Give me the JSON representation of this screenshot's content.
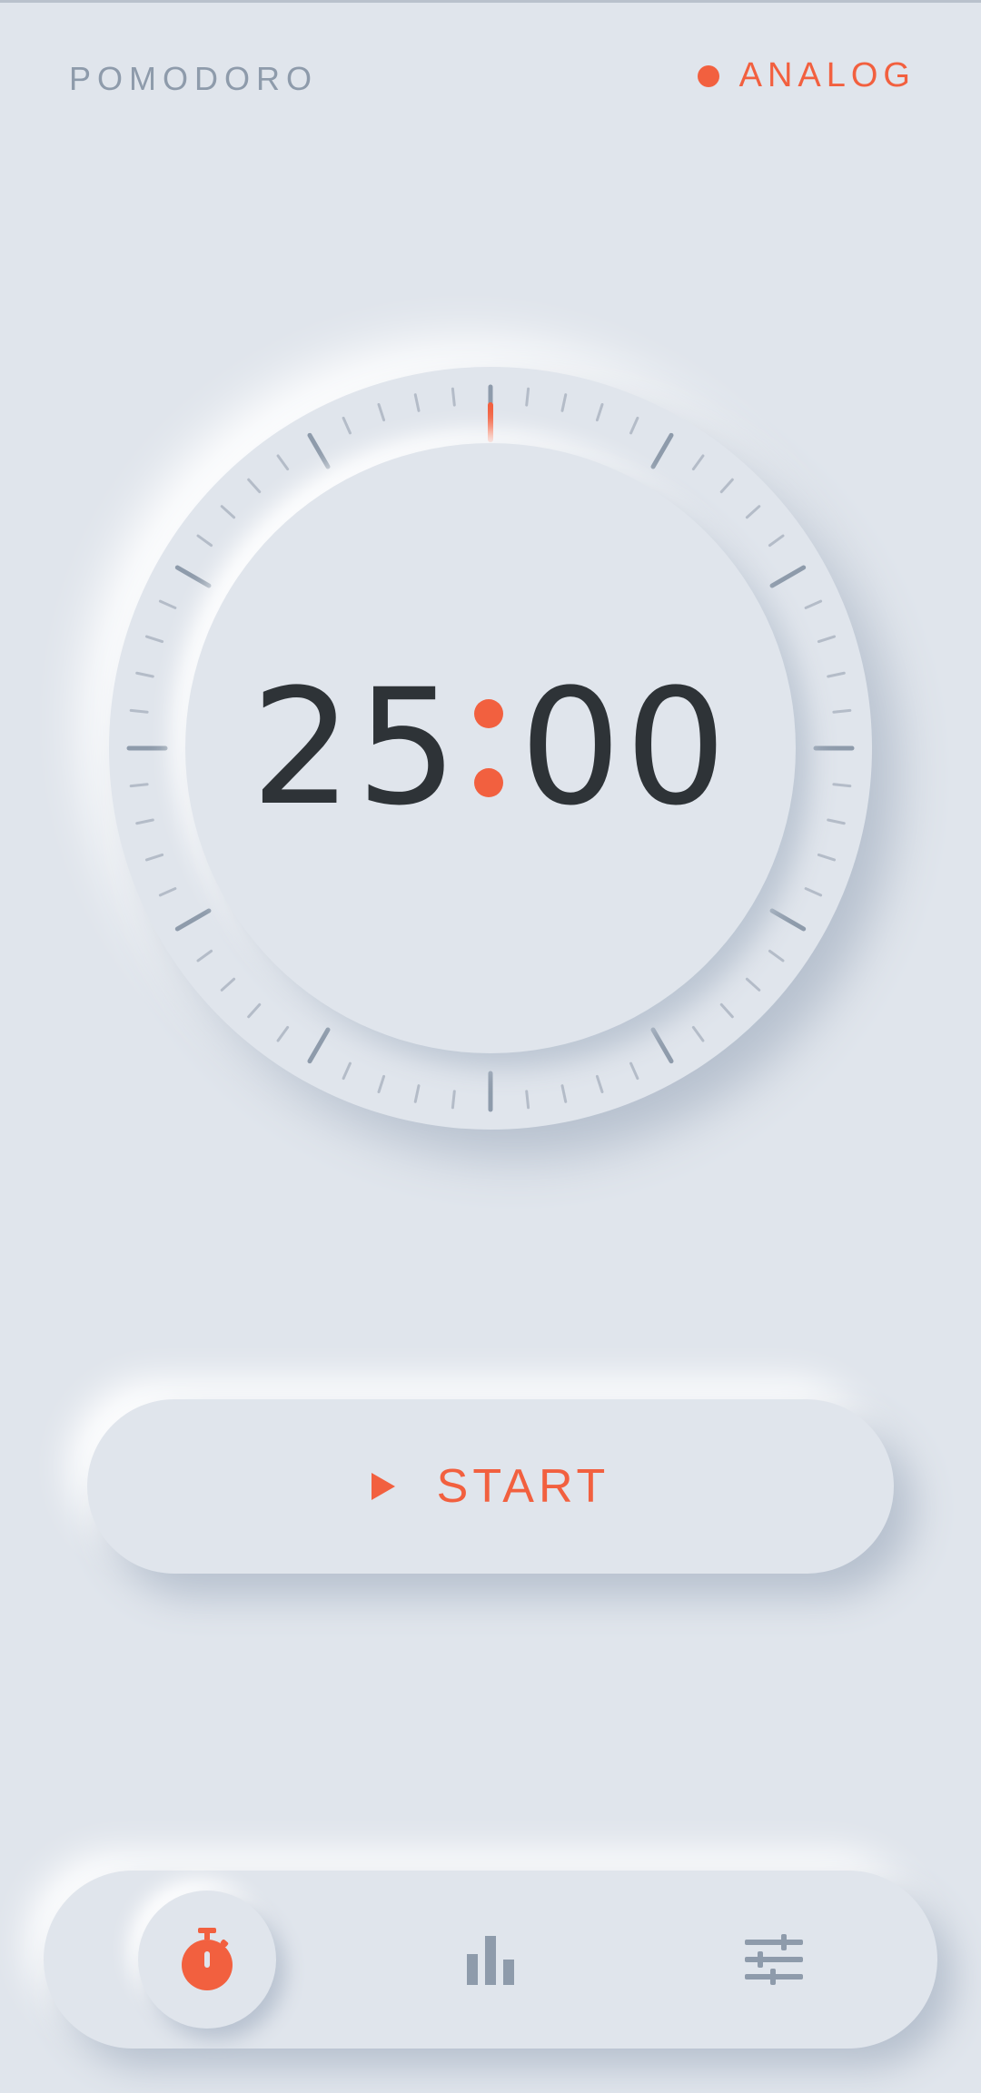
{
  "header": {
    "app_title": "POMODORO",
    "mode_label": "ANALOG"
  },
  "timer": {
    "minutes": "25",
    "seconds": "00",
    "progress_fraction": 0
  },
  "actions": {
    "start_label": "START"
  },
  "nav": {
    "items": [
      {
        "icon": "stopwatch-icon",
        "active": true
      },
      {
        "icon": "bar-chart-icon",
        "active": false
      },
      {
        "icon": "sliders-icon",
        "active": false
      }
    ]
  },
  "colors": {
    "background": "#e0e5ec",
    "accent": "#f2603f",
    "text_dark": "#2e3337",
    "muted": "#8e9bab"
  }
}
